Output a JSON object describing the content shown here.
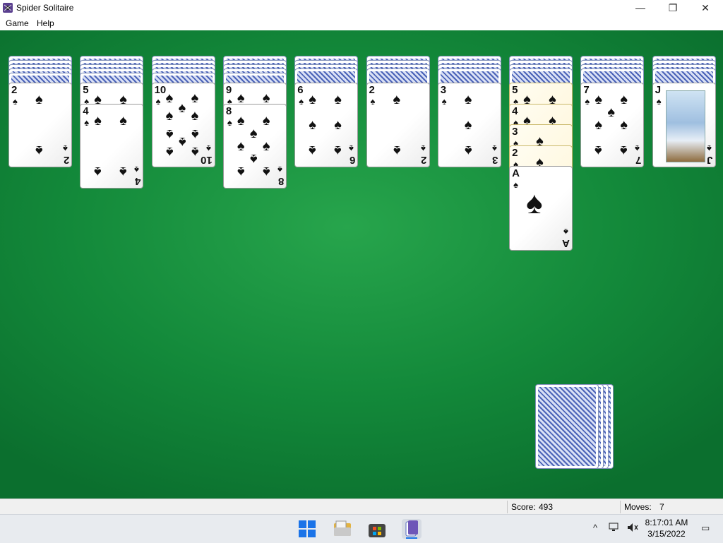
{
  "window": {
    "title": "Spider Solitaire",
    "minimize_glyph": "—",
    "maximize_glyph": "❐",
    "close_glyph": "✕"
  },
  "menu": {
    "items": [
      "Game",
      "Help"
    ]
  },
  "piles": [
    {
      "backs": 5,
      "faces": [
        "2"
      ]
    },
    {
      "backs": 5,
      "faces": [
        "5",
        "4"
      ]
    },
    {
      "backs": 5,
      "faces": [
        "10"
      ]
    },
    {
      "backs": 5,
      "faces": [
        "9",
        "8"
      ]
    },
    {
      "backs": 4,
      "faces": [
        "6"
      ]
    },
    {
      "backs": 4,
      "faces": [
        "2"
      ]
    },
    {
      "backs": 4,
      "faces": [
        "3"
      ]
    },
    {
      "backs": 4,
      "faces": [
        "5",
        "4",
        "3",
        "2",
        "A"
      ],
      "highlighted": true
    },
    {
      "backs": 4,
      "faces": [
        "7"
      ]
    },
    {
      "backs": 4,
      "faces": [
        "J"
      ]
    }
  ],
  "stock": {
    "stacks": 4
  },
  "status": {
    "score_label": "Score:",
    "score": "493",
    "moves_label": "Moves:",
    "moves": "7"
  },
  "taskbar": {
    "time": "8:17:01 AM",
    "date": "3/15/2022",
    "tray_up_glyph": "^",
    "notification_glyph": "▭"
  },
  "icons": {
    "app": "spider-icon",
    "start": "windows-start-icon",
    "explorer": "file-explorer-icon",
    "store": "store-icon",
    "spider_task": "spider-solitaire-task-icon"
  },
  "colors": {
    "felt": "#13893a",
    "card_back": "#4b63b8",
    "highlight": "#fff8e0"
  }
}
